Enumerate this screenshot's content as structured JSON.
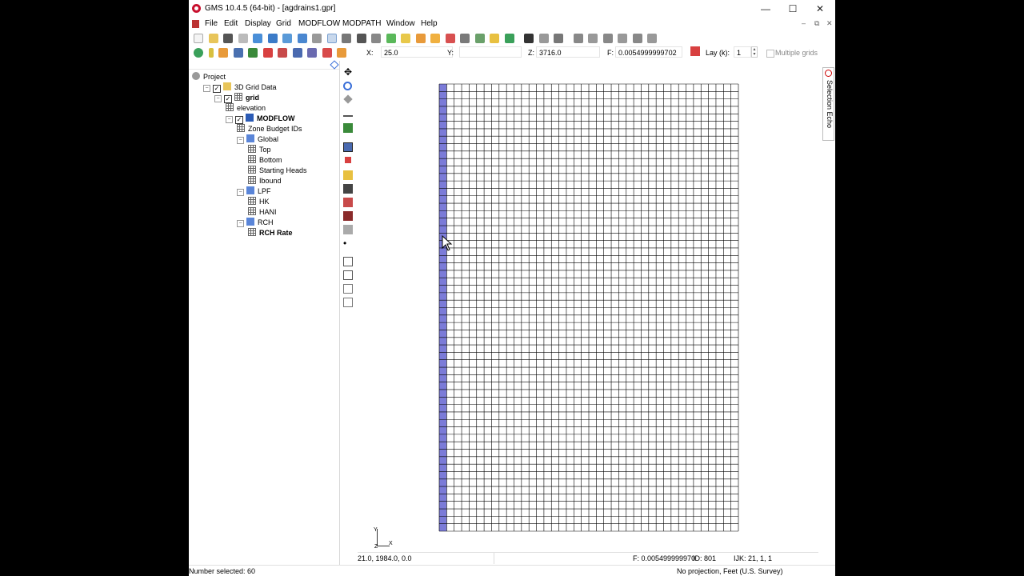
{
  "window": {
    "title": "GMS 10.4.5 (64-bit) - [agdrains1.gpr]",
    "controls": {
      "minimize": "—",
      "maximize": "☐",
      "close": "✕"
    }
  },
  "menu": [
    "File",
    "Edit",
    "Display",
    "Grid",
    "MODFLOW",
    "MODPATH",
    "Window",
    "Help"
  ],
  "mdi_controls": {
    "minimize": "–",
    "restore": "⧉",
    "close": "✕"
  },
  "coords": {
    "x_label": "X:",
    "x_value": "25.0",
    "y_label": "Y:",
    "y_value": "",
    "z_label": "Z:",
    "z_value": "3716.0",
    "f_label": "F:",
    "f_value": "0.0054999999702"
  },
  "layer": {
    "label": "Lay (k):",
    "value": "1"
  },
  "multiple_grids": {
    "label": "Multiple grids",
    "checked": false
  },
  "tree": [
    {
      "label": "Project",
      "depth": 0,
      "icon": "project-icon",
      "checkbox": false,
      "expander": false,
      "bold": false
    },
    {
      "label": "3D Grid Data",
      "depth": 1,
      "icon": "folder-icon",
      "checkbox": true,
      "expander": true,
      "bold": false
    },
    {
      "label": "grid",
      "depth": 2,
      "icon": "grid-icon",
      "checkbox": true,
      "expander": true,
      "bold": true
    },
    {
      "label": "elevation",
      "depth": 3,
      "icon": "dataset-icon",
      "checkbox": false,
      "expander": false,
      "bold": false
    },
    {
      "label": "MODFLOW",
      "depth": 3,
      "icon": "modflow-icon",
      "checkbox": true,
      "expander": true,
      "bold": true
    },
    {
      "label": "Zone Budget IDs",
      "depth": 4,
      "icon": "dataset-icon",
      "checkbox": false,
      "expander": false,
      "bold": false
    },
    {
      "label": "Global",
      "depth": 4,
      "icon": "package-icon",
      "checkbox": false,
      "expander": true,
      "bold": false
    },
    {
      "label": "Top",
      "depth": 5,
      "icon": "dataset-icon",
      "checkbox": false,
      "expander": false,
      "bold": false
    },
    {
      "label": "Bottom",
      "depth": 5,
      "icon": "dataset-icon",
      "checkbox": false,
      "expander": false,
      "bold": false
    },
    {
      "label": "Starting Heads",
      "depth": 5,
      "icon": "dataset-icon",
      "checkbox": false,
      "expander": false,
      "bold": false
    },
    {
      "label": "Ibound",
      "depth": 5,
      "icon": "dataset-icon",
      "checkbox": false,
      "expander": false,
      "bold": false
    },
    {
      "label": "LPF",
      "depth": 4,
      "icon": "package-icon",
      "checkbox": false,
      "expander": true,
      "bold": false
    },
    {
      "label": "HK",
      "depth": 5,
      "icon": "dataset-icon",
      "checkbox": false,
      "expander": false,
      "bold": false
    },
    {
      "label": "HANI",
      "depth": 5,
      "icon": "dataset-icon",
      "checkbox": false,
      "expander": false,
      "bold": false
    },
    {
      "label": "RCH",
      "depth": 4,
      "icon": "package-icon",
      "checkbox": false,
      "expander": true,
      "bold": false
    },
    {
      "label": "RCH Rate",
      "depth": 5,
      "icon": "dataset-icon",
      "checkbox": false,
      "expander": false,
      "bold": true
    }
  ],
  "grid_view": {
    "rows": 60,
    "cols": 40,
    "selected_column": 1,
    "selected_color": "#7b7bd8",
    "line_color": "#000000"
  },
  "axis_triad": {
    "y": "Y",
    "x": "X",
    "z": "Z"
  },
  "selection_echo": "Selection Echo",
  "status": {
    "coords": "21.0, 1984.0, 0.0",
    "f_value": "F: 0.005499999970",
    "id": "ID: 801",
    "ijk": "IJK: 21, 1, 1",
    "number_selected": "Number selected: 60",
    "projection": "No projection, Feet (U.S. Survey)"
  },
  "colors": {
    "accent": "#2b5bb5",
    "app_red": "#c8102e",
    "selection": "#7b7bd8"
  }
}
